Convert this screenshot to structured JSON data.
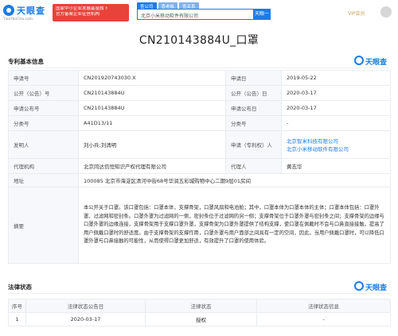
{
  "header": {
    "logo_text": "天眼查",
    "logo_url": "TianYanCha.com",
    "promo_lines": [
      "国家中小企业发展基金旗下",
      "官方备案企业征信机构"
    ],
    "search_tabs": [
      {
        "label": "查公司",
        "active": true
      },
      {
        "label": "查老板",
        "active": false
      },
      {
        "label": "查关系",
        "active": false
      }
    ],
    "search_value": "北京小米移动软件有限公司",
    "search_button": "天眼一下",
    "vip_label": "VIP会员"
  },
  "page_title": "CN210143884U_口罩",
  "basic": {
    "title": "专利基本信息",
    "brand": "天眼查",
    "rows": [
      {
        "k1": "申请号",
        "v1": "CN201920743030.X",
        "k2": "申请日",
        "v2": "2019-05-22"
      },
      {
        "k1": "公开（公告）号",
        "v1": "CN210143884U",
        "k2": "公开（公告）日",
        "v2": "2020-03-17"
      },
      {
        "k1": "申请公布号",
        "v1": "CN210143884U",
        "k2": "申请公布日",
        "v2": "2020-03-17"
      },
      {
        "k1": "分类号",
        "v1": "A41D13/11",
        "k2": "分类号",
        "v2": "-"
      }
    ],
    "inventor_label": "发明人",
    "inventor_value": "刘小兵;刘清明",
    "applicant_label": "申请（专利权）人",
    "applicants": [
      "北京智米科技有限公司",
      "北京小米移动软件有限公司"
    ],
    "agency_label": "代理机构",
    "agency_value": "北京同达信恒知识产权代理有限公司",
    "agent_label": "代理人",
    "agent_value": "黄志华",
    "address_label": "地址",
    "address_value": "100085 北京市海淀区清河中街68号华润五彩城购物中心二期9层01房间",
    "abstract_label": "摘要",
    "abstract_value": "本公开关于口罩。该口罩包括：口罩本体，支撑骨架，口罩风扇和电池舱；其中，口罩本体为口罩本体的主体；口罩本体包括：口罩外罩、过滤网和密封条。口罩外罩为过滤网的一侧，密封条位于过滤网的另一侧；支撑骨架位于口罩外罩与密封条之间；支撑骨架的边缘与口罩外罩的边缘连接，支撑骨架用于支撑口罩外罩，支撑骨架为口罩外罩提供了结构支撑，使口罩在佩戴时不会与口鼻直接接触，提高了用户佩戴口罩时的舒适度。由于支撑骨架的支撑作用，口罩外罩与用户面部之间具有一定的空间，因此，当用户佩戴口罩时，可以降低口罩外罩与口鼻接触的可能性，从而使得口罩更加舒适，有效提升了口罩的使用体验。"
  },
  "legal": {
    "title": "法律状态",
    "brand": "天眼查",
    "headers": [
      "序号",
      "法律状态公告日",
      "法律状态",
      "法律状态信息"
    ],
    "rows": [
      {
        "no": "1",
        "date": "2020-03-17",
        "status": "授权",
        "info": "-"
      }
    ]
  }
}
